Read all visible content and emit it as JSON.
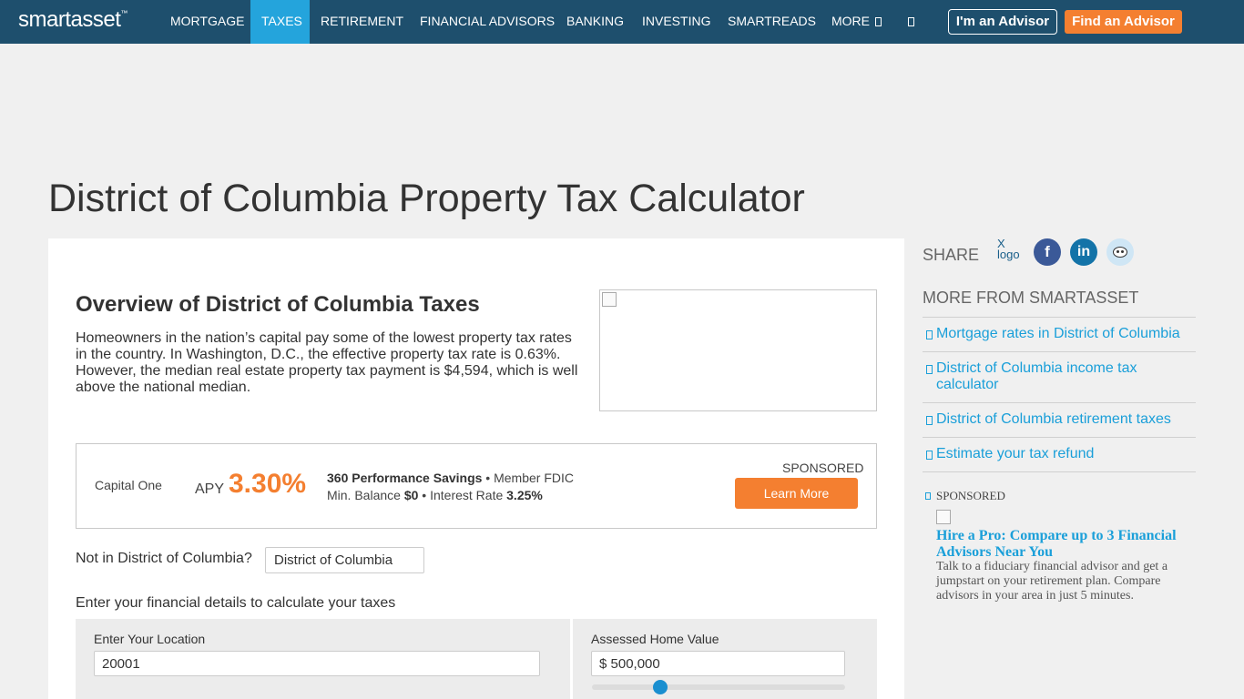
{
  "nav": {
    "logo": "smartasset",
    "logo_tm": "™",
    "items": [
      "MORTGAGE",
      "TAXES",
      "RETIREMENT",
      "FINANCIAL ADVISORS",
      "BANKING",
      "INVESTING",
      "SMARTREADS",
      "MORE"
    ],
    "active": "TAXES",
    "more_icon": "chevron-down-icon",
    "search_icon": "search-icon",
    "advisor_button": "I'm an Advisor",
    "find_button": "Find an Advisor"
  },
  "page_title": "District of Columbia Property Tax Calculator",
  "overview": {
    "title": "Overview of District of Columbia Taxes",
    "text": "Homeowners in the nation’s capital pay some of the lowest property tax rates in the country. In Washington, D.C., the effective property tax rate is 0.63%. However, the median real estate property tax payment is $4,594, which is well above the national median."
  },
  "promo": {
    "logo_alt": "Capital One",
    "apy_label": "APY",
    "apy_value": "3.30%",
    "product": "360 Performance Savings",
    "fdic": "Member FDIC",
    "min_balance_label": "Min. Balance",
    "min_balance_value": "$0",
    "interest_label": "Interest Rate",
    "interest_value": "3.25%",
    "sponsored": "SPONSORED",
    "cta": "Learn More"
  },
  "calculator": {
    "not_in_label": "Not in District of Columbia?",
    "state_value": "District of Columbia",
    "enter_details": "Enter your financial details to calculate your taxes",
    "location_label": "Enter Your Location",
    "location_value": "20001",
    "home_value_label": "Assessed Home Value",
    "home_value": "$ 500,000",
    "slider_fraction": 0.27
  },
  "sidebar": {
    "share_label": "SHARE",
    "x_logo_alt": "X logo",
    "facebook_glyph": "f",
    "linkedin_glyph": "in",
    "more_header": "MORE FROM SMARTASSET",
    "links": [
      "Mortgage rates in District of Columbia",
      "District of Columbia income tax calculator",
      "District of Columbia retirement taxes",
      "Estimate your tax refund"
    ],
    "sponsored_label": "SPONSORED",
    "sponsored_title": "Hire a Pro: Compare up to 3 Financial Advisors Near You",
    "sponsored_desc": "Talk to a fiduciary financial advisor and get a jumpstart on your retirement plan. Compare advisors in your area in just 5 minutes."
  },
  "colors": {
    "nav_bg": "#1e4f6d",
    "nav_active": "#24a4dc",
    "accent_orange": "#f47f30",
    "link_blue": "#1a9fd9",
    "facebook": "#3b5998",
    "linkedin": "#1373a8"
  }
}
